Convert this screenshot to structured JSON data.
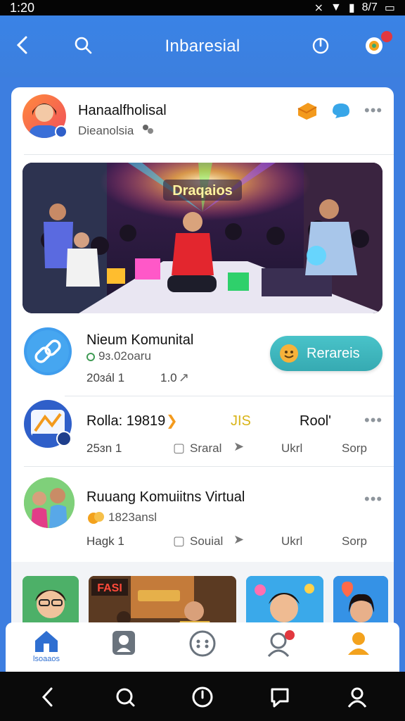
{
  "status": {
    "time": "1:20",
    "right_text": "8/7"
  },
  "appbar": {
    "title": "Inbaresial"
  },
  "post": {
    "author": "Hanaalfholisal",
    "subtitle": "Dieanolsia",
    "hero_sign": "Draqaios"
  },
  "rows": [
    {
      "title": "Nieum Komunital",
      "sub": "9ɜ.02oaru",
      "meta_left": "20ɜál 1",
      "meta_right": "1.0",
      "action_label": "Rerareis"
    },
    {
      "title": "Rolla: 19819",
      "mid_tag": "JIS",
      "right_label": "Rool'",
      "meta": [
        "25ɜn 1",
        "Sraral",
        "Ukrl",
        "Sorp"
      ]
    },
    {
      "title": "Ruuang Komuiitns Virtual",
      "sub": "1823ansl",
      "meta": [
        "Hagk 1",
        "Souial",
        "Ukrl",
        "Sorp"
      ]
    }
  ],
  "thumbs": {
    "sign_text": "FASI"
  },
  "bottomnav": {
    "home_label": "lsoaaos"
  },
  "colors": {
    "primary": "#3b7fe0",
    "accent": "#3fb7be",
    "red": "#e2383f",
    "orange": "#f3a21d"
  }
}
